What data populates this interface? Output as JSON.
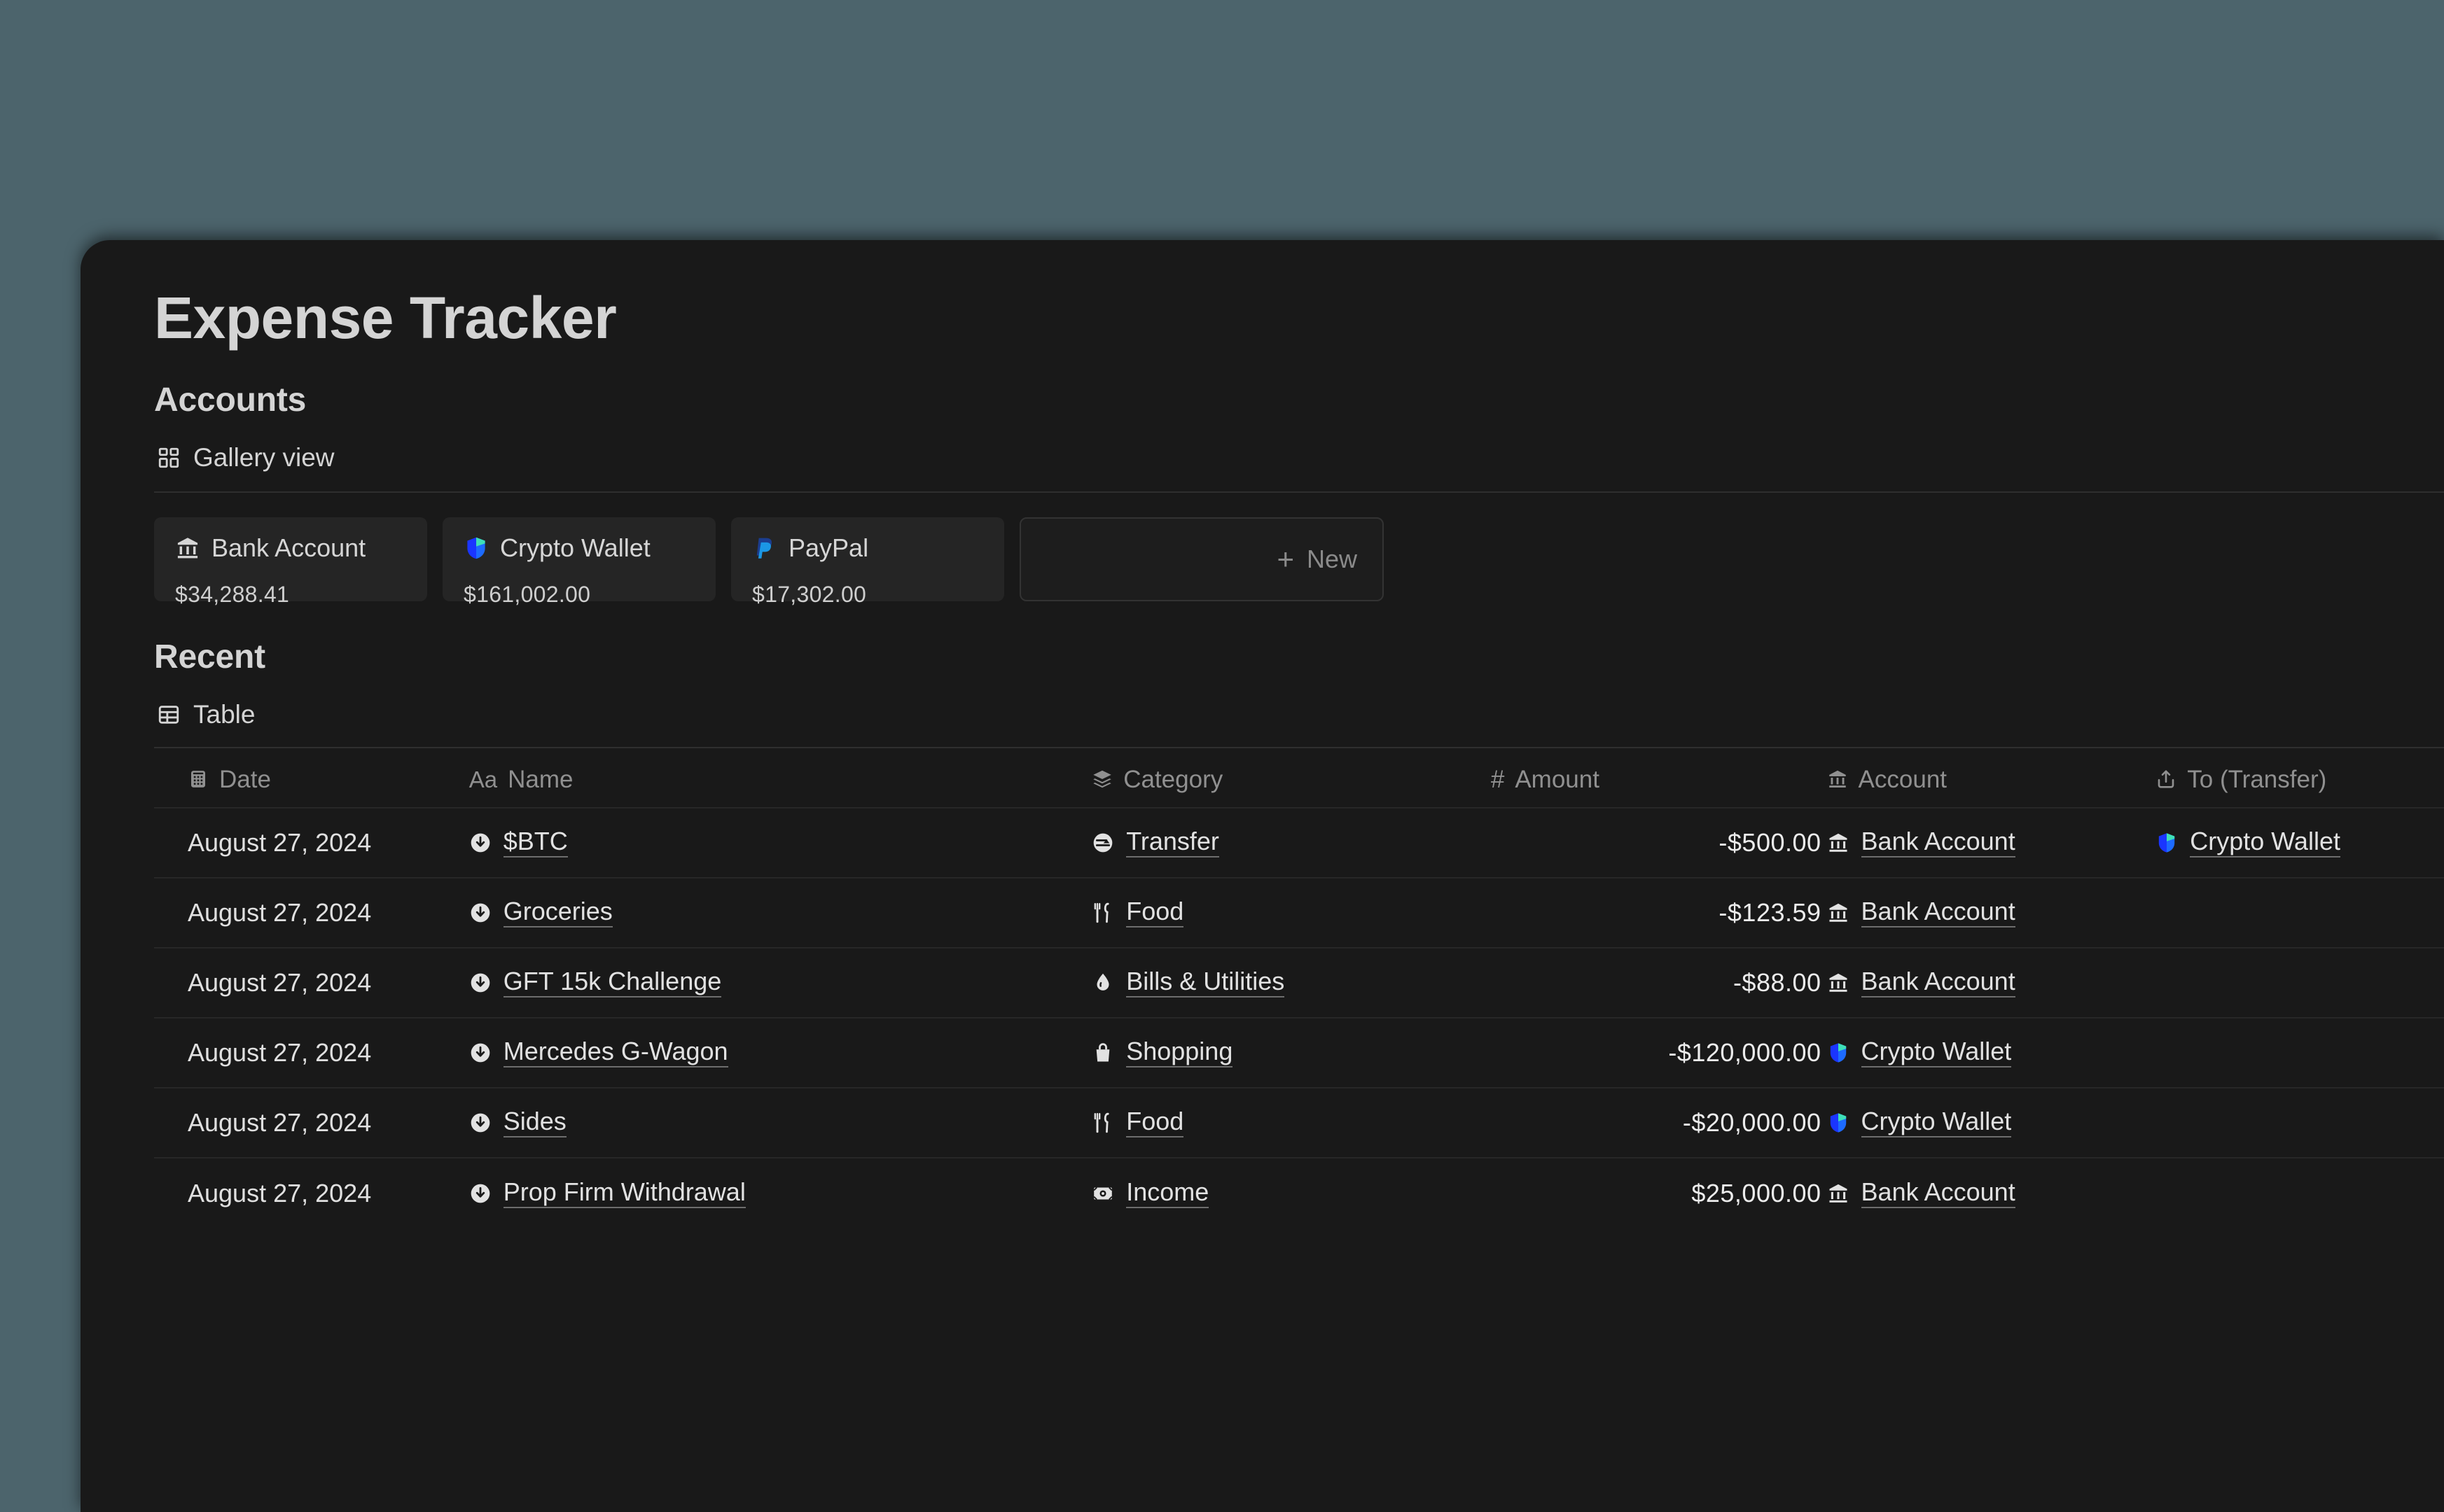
{
  "window": {
    "title": "Expense Tracker"
  },
  "accounts_section": {
    "heading": "Accounts",
    "view": {
      "label": "Gallery view",
      "icon": "gallery-view-icon"
    },
    "cards": [
      {
        "icon": "bank-icon",
        "name": "Bank Account",
        "value": "$34,288.41"
      },
      {
        "icon": "shield-icon",
        "name": "Crypto Wallet",
        "value": "$161,002.00"
      },
      {
        "icon": "paypal-icon",
        "name": "PayPal",
        "value": "$17,302.00"
      }
    ],
    "new_card": {
      "label": "New",
      "icon": "plus-icon"
    }
  },
  "recent_section": {
    "heading": "Recent",
    "view": {
      "label": "Table",
      "icon": "table-view-icon"
    },
    "columns": [
      {
        "label": "Date",
        "icon": "calendar-icon"
      },
      {
        "label": "Name",
        "icon": "aa-text-icon"
      },
      {
        "label": "Category",
        "icon": "layers-icon"
      },
      {
        "label": "Amount",
        "icon": "hash-icon"
      },
      {
        "label": "Account",
        "icon": "bank-icon"
      },
      {
        "label": "To (Transfer)",
        "icon": "share-up-icon"
      }
    ],
    "rows": [
      {
        "date": "August 27, 2024",
        "name": "$BTC",
        "name_icon": "arrow-down-circle-icon",
        "category": "Transfer",
        "category_icon": "transfer-icon",
        "amount": "-$500.00",
        "account": "Bank Account",
        "account_icon": "bank-icon",
        "to_transfer": "Crypto Wallet",
        "to_transfer_icon": "shield-icon"
      },
      {
        "date": "August 27, 2024",
        "name": "Groceries",
        "name_icon": "arrow-down-circle-icon",
        "category": "Food",
        "category_icon": "fork-knife-icon",
        "amount": "-$123.59",
        "account": "Bank Account",
        "account_icon": "bank-icon",
        "to_transfer": "",
        "to_transfer_icon": ""
      },
      {
        "date": "August 27, 2024",
        "name": "GFT 15k Challenge",
        "name_icon": "arrow-down-circle-icon",
        "category": "Bills & Utilities",
        "category_icon": "droplet-icon",
        "amount": "-$88.00",
        "account": "Bank Account",
        "account_icon": "bank-icon",
        "to_transfer": "",
        "to_transfer_icon": ""
      },
      {
        "date": "August 27, 2024",
        "name": "Mercedes G-Wagon",
        "name_icon": "arrow-down-circle-icon",
        "category": "Shopping",
        "category_icon": "shopping-bag-icon",
        "amount": "-$120,000.00",
        "account": "Crypto Wallet",
        "account_icon": "shield-icon",
        "to_transfer": "",
        "to_transfer_icon": ""
      },
      {
        "date": "August 27, 2024",
        "name": "Sides",
        "name_icon": "arrow-down-circle-icon",
        "category": "Food",
        "category_icon": "fork-knife-icon",
        "amount": "-$20,000.00",
        "account": "Crypto Wallet",
        "account_icon": "shield-icon",
        "to_transfer": "",
        "to_transfer_icon": ""
      },
      {
        "date": "August 27, 2024",
        "name": "Prop Firm Withdrawal",
        "name_icon": "arrow-down-circle-icon",
        "category": "Income",
        "category_icon": "banknote-icon",
        "amount": "$25,000.00",
        "account": "Bank Account",
        "account_icon": "bank-icon",
        "to_transfer": "",
        "to_transfer_icon": ""
      }
    ]
  },
  "colors": {
    "desktop_background": "#4c646c",
    "window_background": "#191919",
    "card_background": "#252525",
    "text_primary": "#d4d4d4",
    "text_muted": "#909090",
    "divider": "#2e2e2e",
    "crypto_blue": "#1a35ff",
    "crypto_teal": "#3ee0b8",
    "paypal_dark_blue": "#1b3d8f",
    "paypal_light_blue": "#1b97e5"
  }
}
